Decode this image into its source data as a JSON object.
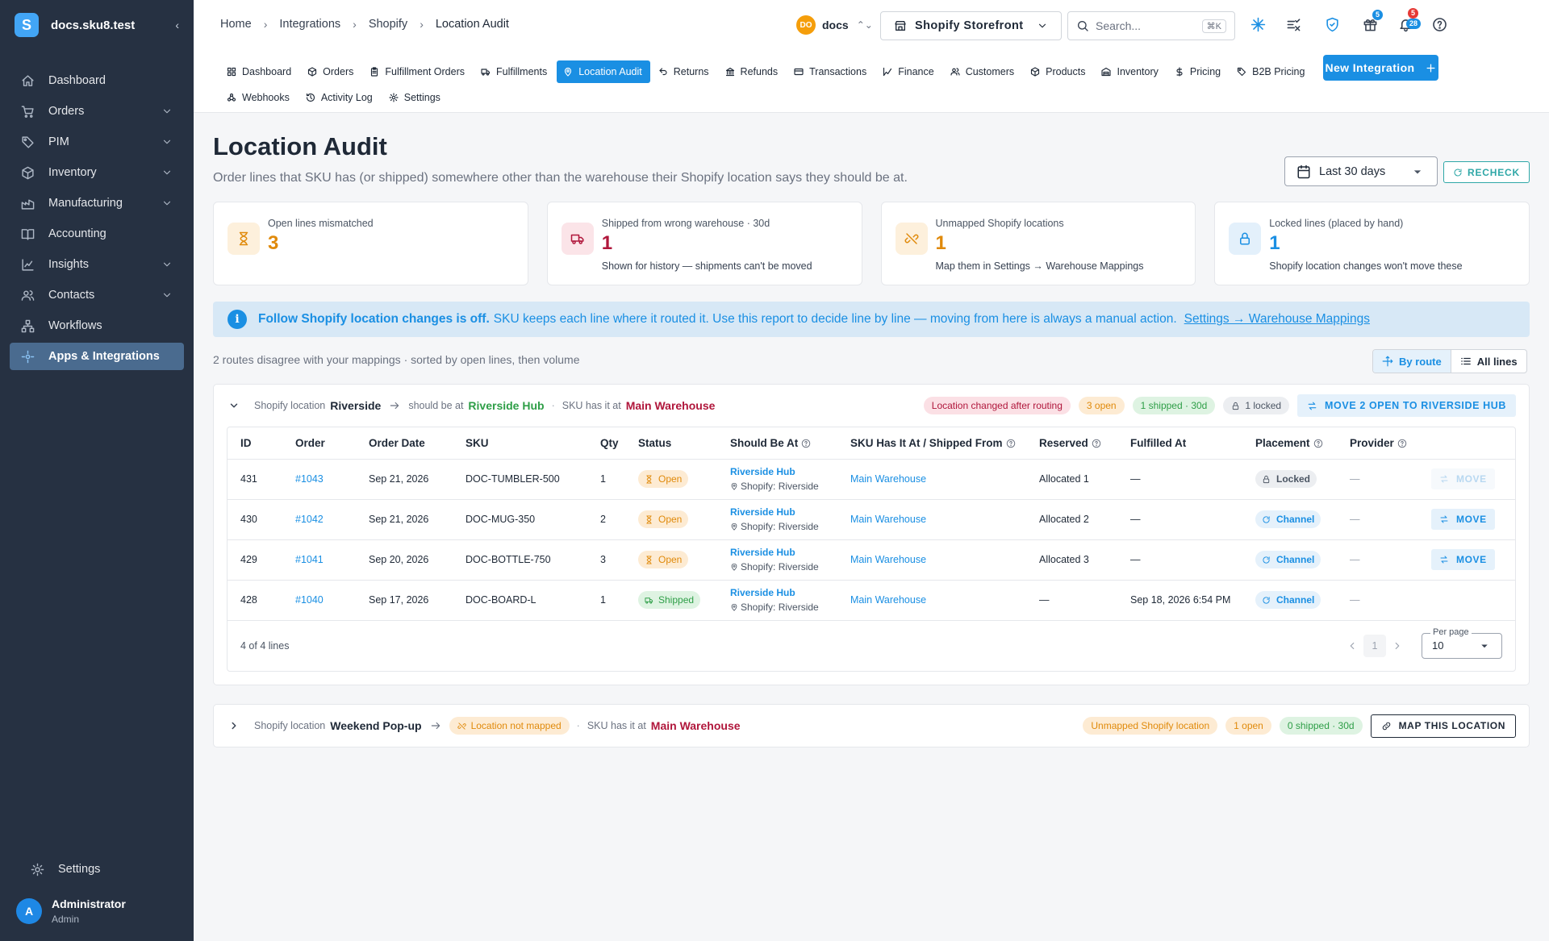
{
  "app": {
    "logo_letter": "S",
    "title": "docs.sku8.test",
    "collapse": "‹"
  },
  "sidebar": {
    "items": [
      {
        "label": "Dashboard",
        "icon": "home-icon",
        "expand": false
      },
      {
        "label": "Orders",
        "icon": "cart-icon",
        "expand": true
      },
      {
        "label": "PIM",
        "icon": "tag-icon",
        "expand": true
      },
      {
        "label": "Inventory",
        "icon": "box-icon",
        "expand": true
      },
      {
        "label": "Manufacturing",
        "icon": "factory-icon",
        "expand": true
      },
      {
        "label": "Accounting",
        "icon": "book-icon",
        "expand": false
      },
      {
        "label": "Insights",
        "icon": "chart-icon",
        "expand": true
      },
      {
        "label": "Contacts",
        "icon": "users-icon",
        "expand": true
      },
      {
        "label": "Workflows",
        "icon": "workflow-icon",
        "expand": false
      },
      {
        "label": "Apps & Integrations",
        "icon": "apps-icon",
        "expand": false,
        "active": true
      }
    ],
    "settings": "Settings",
    "user": {
      "initial": "A",
      "name": "Administrator",
      "role": "Admin"
    }
  },
  "header": {
    "breadcrumbs": [
      "Home",
      "Integrations",
      "Shopify",
      "Location Audit"
    ],
    "tenant": {
      "initials": "DO",
      "name": "docs",
      "switch": "⌃⌄"
    },
    "store": "Shopify Storefront",
    "search": {
      "placeholder": "Search...",
      "shortcut": "⌘K"
    },
    "badges": {
      "gifts": "5",
      "notifications_red": "5",
      "notifications_blue": "28"
    },
    "tabs": [
      {
        "label": "Dashboard",
        "icon": "grid-icon"
      },
      {
        "label": "Orders",
        "icon": "package-icon"
      },
      {
        "label": "Fulfillment Orders",
        "icon": "clipboard-icon"
      },
      {
        "label": "Fulfillments",
        "icon": "truck-icon"
      },
      {
        "label": "Location Audit",
        "icon": "pin-icon",
        "active": true
      },
      {
        "label": "Returns",
        "icon": "return-icon"
      },
      {
        "label": "Refunds",
        "icon": "bank-icon"
      },
      {
        "label": "Transactions",
        "icon": "card-icon"
      },
      {
        "label": "Finance",
        "icon": "finance-icon"
      },
      {
        "label": "Customers",
        "icon": "users-icon"
      },
      {
        "label": "Products",
        "icon": "package-icon"
      },
      {
        "label": "Inventory",
        "icon": "warehouse-icon"
      },
      {
        "label": "Pricing",
        "icon": "dollar-icon"
      },
      {
        "label": "B2B Pricing",
        "icon": "tag-icon"
      },
      {
        "label": "Webhooks",
        "icon": "webhook-icon"
      },
      {
        "label": "Activity Log",
        "icon": "history-icon"
      },
      {
        "label": "Settings",
        "icon": "gear-icon"
      }
    ],
    "new_integration": "New Integration"
  },
  "page": {
    "title": "Location Audit",
    "subtitle": "Order lines that SKU has (or shipped) somewhere other than the warehouse their Shopify location says they should be at.",
    "range": "Last 30 days",
    "recheck": "RECHECK"
  },
  "cards": [
    {
      "label": "Open lines mismatched",
      "value": "3",
      "hint": "",
      "color": "#e08a0b",
      "bg": "#fdf0dc",
      "icon": "hourglass-icon"
    },
    {
      "label": "Shipped from wrong warehouse · 30d",
      "value": "1",
      "hint": "Shown for history — shipments can't be moved",
      "color": "#b0163b",
      "bg": "#fbe4e8",
      "icon": "truck-icon"
    },
    {
      "label": "Unmapped Shopify locations",
      "value": "1",
      "hint": "Map them in Settings → Warehouse Mappings",
      "color": "#e08a0b",
      "bg": "#fdf0dc",
      "icon": "unlink-icon"
    },
    {
      "label": "Locked lines (placed by hand)",
      "value": "1",
      "hint": "Shopify location changes won't move these",
      "color": "#1a8fe3",
      "bg": "#e3f0fb",
      "icon": "lock-icon"
    }
  ],
  "info": {
    "bold": "Follow Shopify location changes is off.",
    "text": "SKU keeps each line where it routed it. Use this report to decide line by line — moving from here is always a manual action.",
    "link": "Settings → Warehouse Mappings"
  },
  "routes_summary": "2 routes disagree with your mappings · sorted by open lines, then volume",
  "view": {
    "by_route": "By route",
    "all_lines": "All lines"
  },
  "group1": {
    "prefix": "Shopify location",
    "location": "Riverside",
    "should_label": "should be at",
    "should": "Riverside Hub",
    "has_label": "SKU has it at",
    "has": "Main Warehouse",
    "pills": {
      "changed": "Location changed after routing",
      "open": "3 open",
      "shipped": "1 shipped · 30d",
      "locked": "1 locked"
    },
    "action": "MOVE 2 OPEN TO RIVERSIDE HUB",
    "columns": [
      "ID",
      "Order",
      "Order Date",
      "SKU",
      "Qty",
      "Status",
      "Should Be At",
      "SKU Has It At / Shipped From",
      "Reserved",
      "Fulfilled At",
      "Placement",
      "Provider"
    ],
    "rows": [
      {
        "id": "431",
        "order": "#1043",
        "date": "Sep 21, 2026",
        "sku": "DOC-TUMBLER-500",
        "qty": "1",
        "status": "Open",
        "should": "Riverside Hub",
        "should_sub": "Shopify: Riverside",
        "has": "Main Warehouse",
        "reserved": "Allocated 1",
        "fulfilled": "—",
        "placement": "Locked",
        "provider": "—",
        "move": "MOVE",
        "move_disabled": true
      },
      {
        "id": "430",
        "order": "#1042",
        "date": "Sep 21, 2026",
        "sku": "DOC-MUG-350",
        "qty": "2",
        "status": "Open",
        "should": "Riverside Hub",
        "should_sub": "Shopify: Riverside",
        "has": "Main Warehouse",
        "reserved": "Allocated 2",
        "fulfilled": "—",
        "placement": "Channel",
        "provider": "—",
        "move": "MOVE",
        "move_disabled": false
      },
      {
        "id": "429",
        "order": "#1041",
        "date": "Sep 20, 2026",
        "sku": "DOC-BOTTLE-750",
        "qty": "3",
        "status": "Open",
        "should": "Riverside Hub",
        "should_sub": "Shopify: Riverside",
        "has": "Main Warehouse",
        "reserved": "Allocated 3",
        "fulfilled": "—",
        "placement": "Channel",
        "provider": "—",
        "move": "MOVE",
        "move_disabled": false
      },
      {
        "id": "428",
        "order": "#1040",
        "date": "Sep 17, 2026",
        "sku": "DOC-BOARD-L",
        "qty": "1",
        "status": "Shipped",
        "should": "Riverside Hub",
        "should_sub": "Shopify: Riverside",
        "has": "Main Warehouse",
        "reserved": "—",
        "fulfilled": "Sep 18, 2026 6:54 PM",
        "placement": "Channel",
        "provider": "—",
        "move": "",
        "move_disabled": true
      }
    ],
    "footer": {
      "count": "4 of 4 lines",
      "page": "1",
      "per_page_label": "Per page",
      "per_page": "10"
    }
  },
  "group2": {
    "prefix": "Shopify location",
    "location": "Weekend Pop-up",
    "not_mapped": "Location not mapped",
    "has_label": "SKU has it at",
    "has": "Main Warehouse",
    "pills": {
      "unmapped": "Unmapped Shopify location",
      "open": "1 open",
      "shipped": "0 shipped · 30d"
    },
    "action": "MAP THIS LOCATION"
  }
}
